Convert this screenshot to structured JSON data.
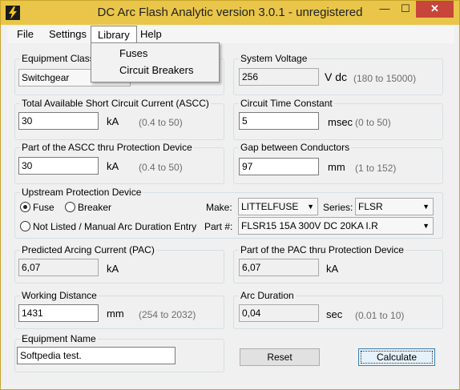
{
  "window": {
    "title": "DC Arc Flash Analytic version 3.0.1 - unregistered",
    "minimize": "—",
    "maximize": "☐",
    "close": "✕"
  },
  "menu": {
    "file": "File",
    "settings": "Settings",
    "library": "Library",
    "help": "Help",
    "library_items": [
      "Fuses",
      "Circuit Breakers"
    ]
  },
  "equipment_class": {
    "label": "Equipment Class",
    "value": "Switchgear"
  },
  "system_voltage": {
    "label": "System Voltage",
    "value": "256",
    "unit": "V dc",
    "range": "(180 to 15000)"
  },
  "ascc": {
    "label": "Total Available Short Circuit Current (ASCC)",
    "value": "30",
    "unit": "kA",
    "range": "(0.4 to 50)"
  },
  "time_constant": {
    "label": "Circuit Time Constant",
    "value": "5",
    "unit": "msec",
    "range": "(0 to 50)"
  },
  "ascc_part": {
    "label": "Part of the ASCC thru Protection Device",
    "value": "30",
    "unit": "kA",
    "range": "(0.4 to 50)"
  },
  "gap": {
    "label": "Gap between Conductors",
    "value": "97",
    "unit": "mm",
    "range": "(1 to 152)"
  },
  "protection": {
    "label": "Upstream Protection Device",
    "fuse": "Fuse",
    "breaker": "Breaker",
    "not_listed": "Not Listed / Manual Arc Duration Entry",
    "selected": "fuse",
    "make_label": "Make:",
    "make_value": "LITTELFUSE",
    "series_label": "Series:",
    "series_value": "FLSR",
    "part_label": "Part #:",
    "part_value": "FLSR15 15A 300V DC 20KA I.R"
  },
  "pac": {
    "label": "Predicted Arcing Current (PAC)",
    "value": "6,07",
    "unit": "kA"
  },
  "pac_part": {
    "label": "Part of the PAC thru Protection Device",
    "value": "6,07",
    "unit": "kA"
  },
  "working_distance": {
    "label": "Working Distance",
    "value": "1431",
    "unit": "mm",
    "range": "(254 to 2032)"
  },
  "arc_duration": {
    "label": "Arc Duration",
    "value": "0,04",
    "unit": "sec",
    "range": "(0.01 to 10)"
  },
  "equipment_name": {
    "label": "Equipment Name",
    "value": "Softpedia test."
  },
  "buttons": {
    "reset": "Reset",
    "calculate": "Calculate"
  },
  "colors": {
    "titlebar": "#e9c64a",
    "close": "#c7453a",
    "window": "#f0f0f0"
  }
}
